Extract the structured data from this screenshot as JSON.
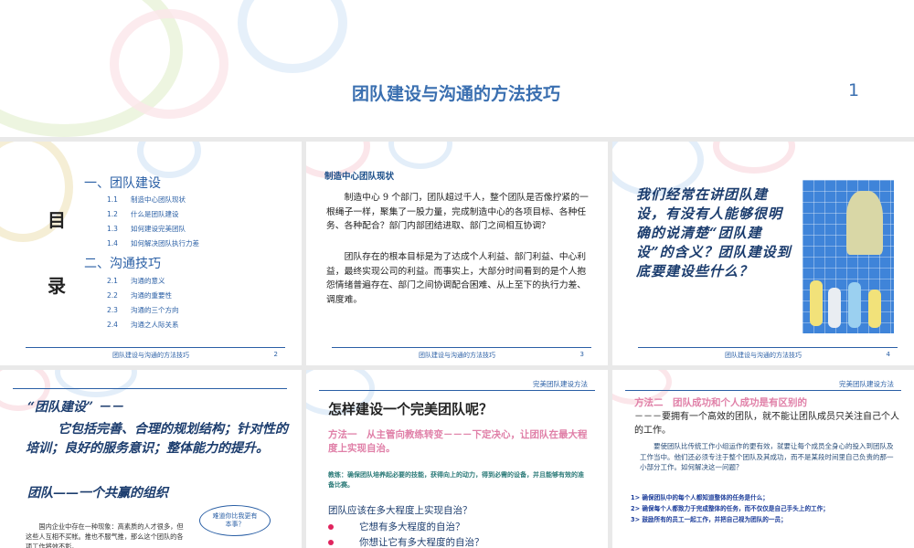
{
  "title_slide": {
    "title": "团队建设与沟通的方法技巧",
    "page": "1"
  },
  "toc_slide": {
    "side_label_1": "目",
    "side_label_2": "录",
    "section1": "一、团队建设",
    "items1": [
      {
        "num": "1.1",
        "text": "制造中心团队现状"
      },
      {
        "num": "1.2",
        "text": "什么是团队建设"
      },
      {
        "num": "1.3",
        "text": "如何建设完美团队"
      },
      {
        "num": "1.4",
        "text": "如何解决团队执行力差"
      }
    ],
    "section2": "二、沟通技巧",
    "items2": [
      {
        "num": "2.1",
        "text": "沟通的意义"
      },
      {
        "num": "2.2",
        "text": "沟通的重要性"
      },
      {
        "num": "2.3",
        "text": "沟通的三个方向"
      },
      {
        "num": "2.4",
        "text": "沟通之人际关系"
      }
    ],
    "footer": "团队建设与沟通的方法技巧",
    "page": "2"
  },
  "status_slide": {
    "heading": "制造中心团队现状",
    "para1": "制造中心 9 个部门，团队超过千人，整个团队是否像拧紧的一根绳子一样，聚集了一股力量，完成制造中心的各项目标、各种任务、各种配合？部门内部团结进取、部门之间相互协调？",
    "para2": "团队存在的根本目标是为了达成个人利益、部门利益、中心利益，最终实现公司的利益。而事实上，大部分时间看到的是个人抱怨情绪普遍存在、部门之间协调配合困难、从上至下的执行力差、调度难。",
    "footer": "团队建设与沟通的方法技巧",
    "page": "3"
  },
  "question_slide": {
    "text": "我们经常在讲团队建设，有没有人能够很明确的说清楚“团队建设”的含义？团队建设到底要建设些什么？",
    "footer": "团队建设与沟通的方法技巧",
    "page": "4"
  },
  "definition_slide": {
    "quote": "“团队建设” －－",
    "body": "它包括完善、合理的规划结构；针对性的培训；良好的服务意识；整体能力的提升。",
    "subtitle": "团队——一个共赢的组织",
    "bubble": "难道你比我更有本事？",
    "small": "国内企业中存在一种现象：高素质的人才很多，但这些人互相不买帐。推也不服气推，那么这个团队的各项工作将效不彰。"
  },
  "perfect_slide": {
    "header": "完美团队建设方法",
    "title": "怎样建设一个完美团队呢？",
    "method": "方法一　从主管向教练转变－－－下定决心，让团队在最大程度上实现自治。",
    "coach": "教练：确保团队培养起必要的技能，获得向上的动力，得到必需的设备，并且能够有效的准备比赛。",
    "question": "团队应该在多大程度上实现自治？",
    "bullets": [
      "它想有多大程度的自治？",
      "你想让它有多大程度的自治？"
    ],
    "bullet_color": "#e0245e"
  },
  "method2_slide": {
    "header": "完美团队建设方法",
    "title": "方法二　团队成功和个人成功是有区别的",
    "lead": "－－－要拥有一个高效的团队，就不能让团队成员只关注自己个人的工作。",
    "para": "要使团队比传统工作小组运作的更有效，就要让每个成员全身心的投入到团队及工作当中。他们还必须专注于整个团队及其成功，而不是某段时间里自己负责的那一小部分工作。如何解决这一问题？",
    "points": [
      "1> 确保团队中的每个人都知道整体的任务是什么；",
      "2> 确保每个人都致力于完成整体的任务，而不仅仅是自己手头上的工作；",
      "3> 鼓励所有的员工一起工作，并把自己视为团队的一员；"
    ]
  },
  "colors": {
    "accent_blue": "#2a5fa5",
    "title_blue": "#3a6fb0",
    "teal_heading": "#2b7a78",
    "pink": "#e080a8",
    "handwriting": "#1c3d6e"
  }
}
